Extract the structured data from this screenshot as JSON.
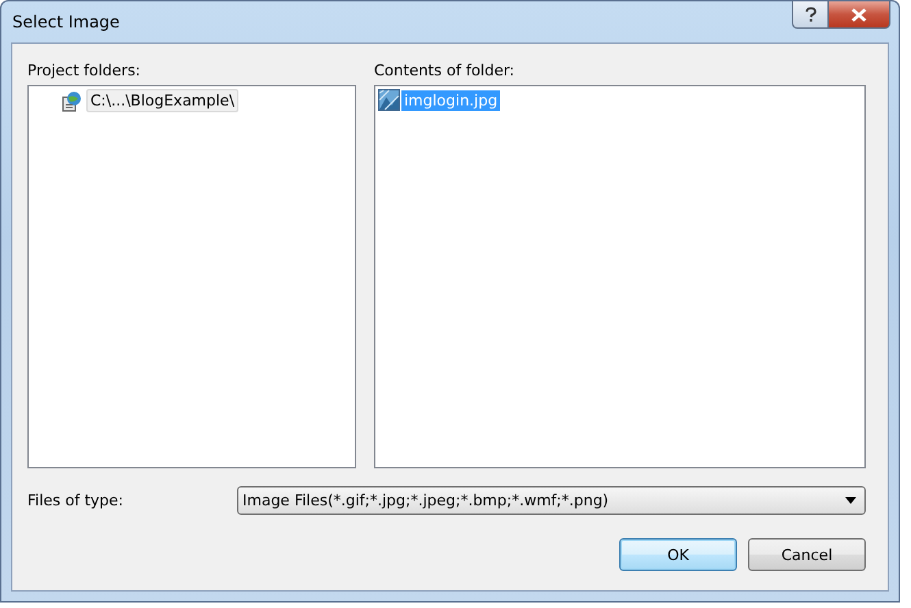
{
  "window": {
    "title": "Select Image"
  },
  "project_folders": {
    "label": "Project folders:",
    "items": [
      {
        "label": "C:\\...\\BlogExample\\",
        "selected": true
      }
    ]
  },
  "contents": {
    "label": "Contents of folder:",
    "items": [
      {
        "label": "imglogin.jpg",
        "selected": true
      }
    ]
  },
  "file_type": {
    "label": "Files of type:",
    "value": "Image Files(*.gif;*.jpg;*.jpeg;*.bmp;*.wmf;*.png)"
  },
  "buttons": [
    {
      "label": "OK",
      "default": true
    },
    {
      "label": "Cancel",
      "default": false
    }
  ]
}
